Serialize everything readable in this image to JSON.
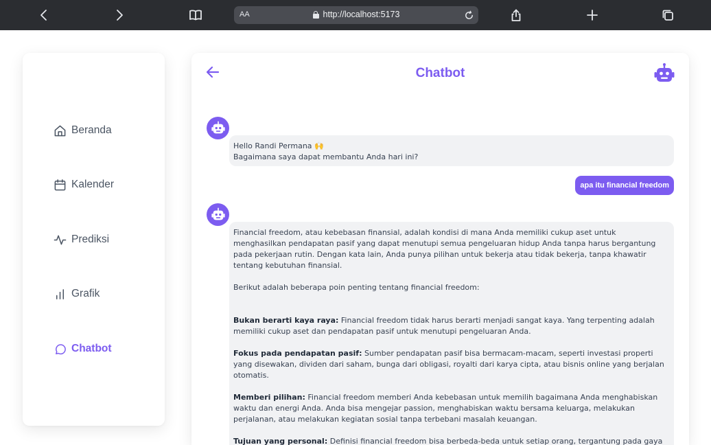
{
  "browser": {
    "aa_label": "AA",
    "url": "http://localhost:5173"
  },
  "sidebar": {
    "items": [
      {
        "label": "Beranda",
        "icon": "home-icon"
      },
      {
        "label": "Kalender",
        "icon": "calendar-icon"
      },
      {
        "label": "Prediksi",
        "icon": "activity-icon"
      },
      {
        "label": "Grafik",
        "icon": "bar-chart-icon"
      },
      {
        "label": "Chatbot",
        "icon": "message-circle-icon",
        "active": true
      }
    ]
  },
  "chat": {
    "title": "Chatbot",
    "accent_color": "#7c5cf0",
    "messages": [
      {
        "sender": "bot",
        "lines": [
          "Hello Randi Permana 🙌",
          "Bagaimana saya dapat membantu Anda hari ini?"
        ]
      },
      {
        "sender": "user",
        "text": "apa itu financial freedom"
      },
      {
        "sender": "bot",
        "intro": "Financial freedom, atau kebebasan finansial, adalah kondisi di mana Anda memiliki cukup aset untuk menghasilkan pendapatan pasif yang dapat menutupi semua pengeluaran hidup Anda tanpa harus bergantung pada pekerjaan rutin. Dengan kata lain, Anda punya pilihan untuk bekerja atau tidak bekerja, tanpa khawatir tentang kebutuhan finansial.",
        "lead": "Berikut adalah beberapa poin penting tentang financial freedom:",
        "points": [
          {
            "title": "Bukan berarti kaya raya:",
            "text": "Financial freedom tidak harus berarti menjadi sangat kaya. Yang terpenting adalah memiliki cukup aset dan pendapatan pasif untuk menutupi pengeluaran Anda."
          },
          {
            "title": "Fokus pada pendapatan pasif:",
            "text": "Sumber pendapatan pasif bisa bermacam-macam, seperti investasi properti yang disewakan, dividen dari saham, bunga dari obligasi, royalti dari karya cipta, atau bisnis online yang berjalan otomatis."
          },
          {
            "title": "Memberi pilihan:",
            "text": "Financial freedom memberi Anda kebebasan untuk memilih bagaimana Anda menghabiskan waktu dan energi Anda. Anda bisa mengejar passion, menghabiskan waktu bersama keluarga, melakukan perjalanan, atau melakukan kegiatan sosial tanpa terbebani masalah keuangan."
          },
          {
            "title": "Tujuan yang personal:",
            "text": "Definisi financial freedom bisa berbeda-beda untuk setiap orang, tergantung pada gaya hidup, kebutuhan, dan tujuan finansial masing-masing."
          }
        ]
      }
    ]
  }
}
